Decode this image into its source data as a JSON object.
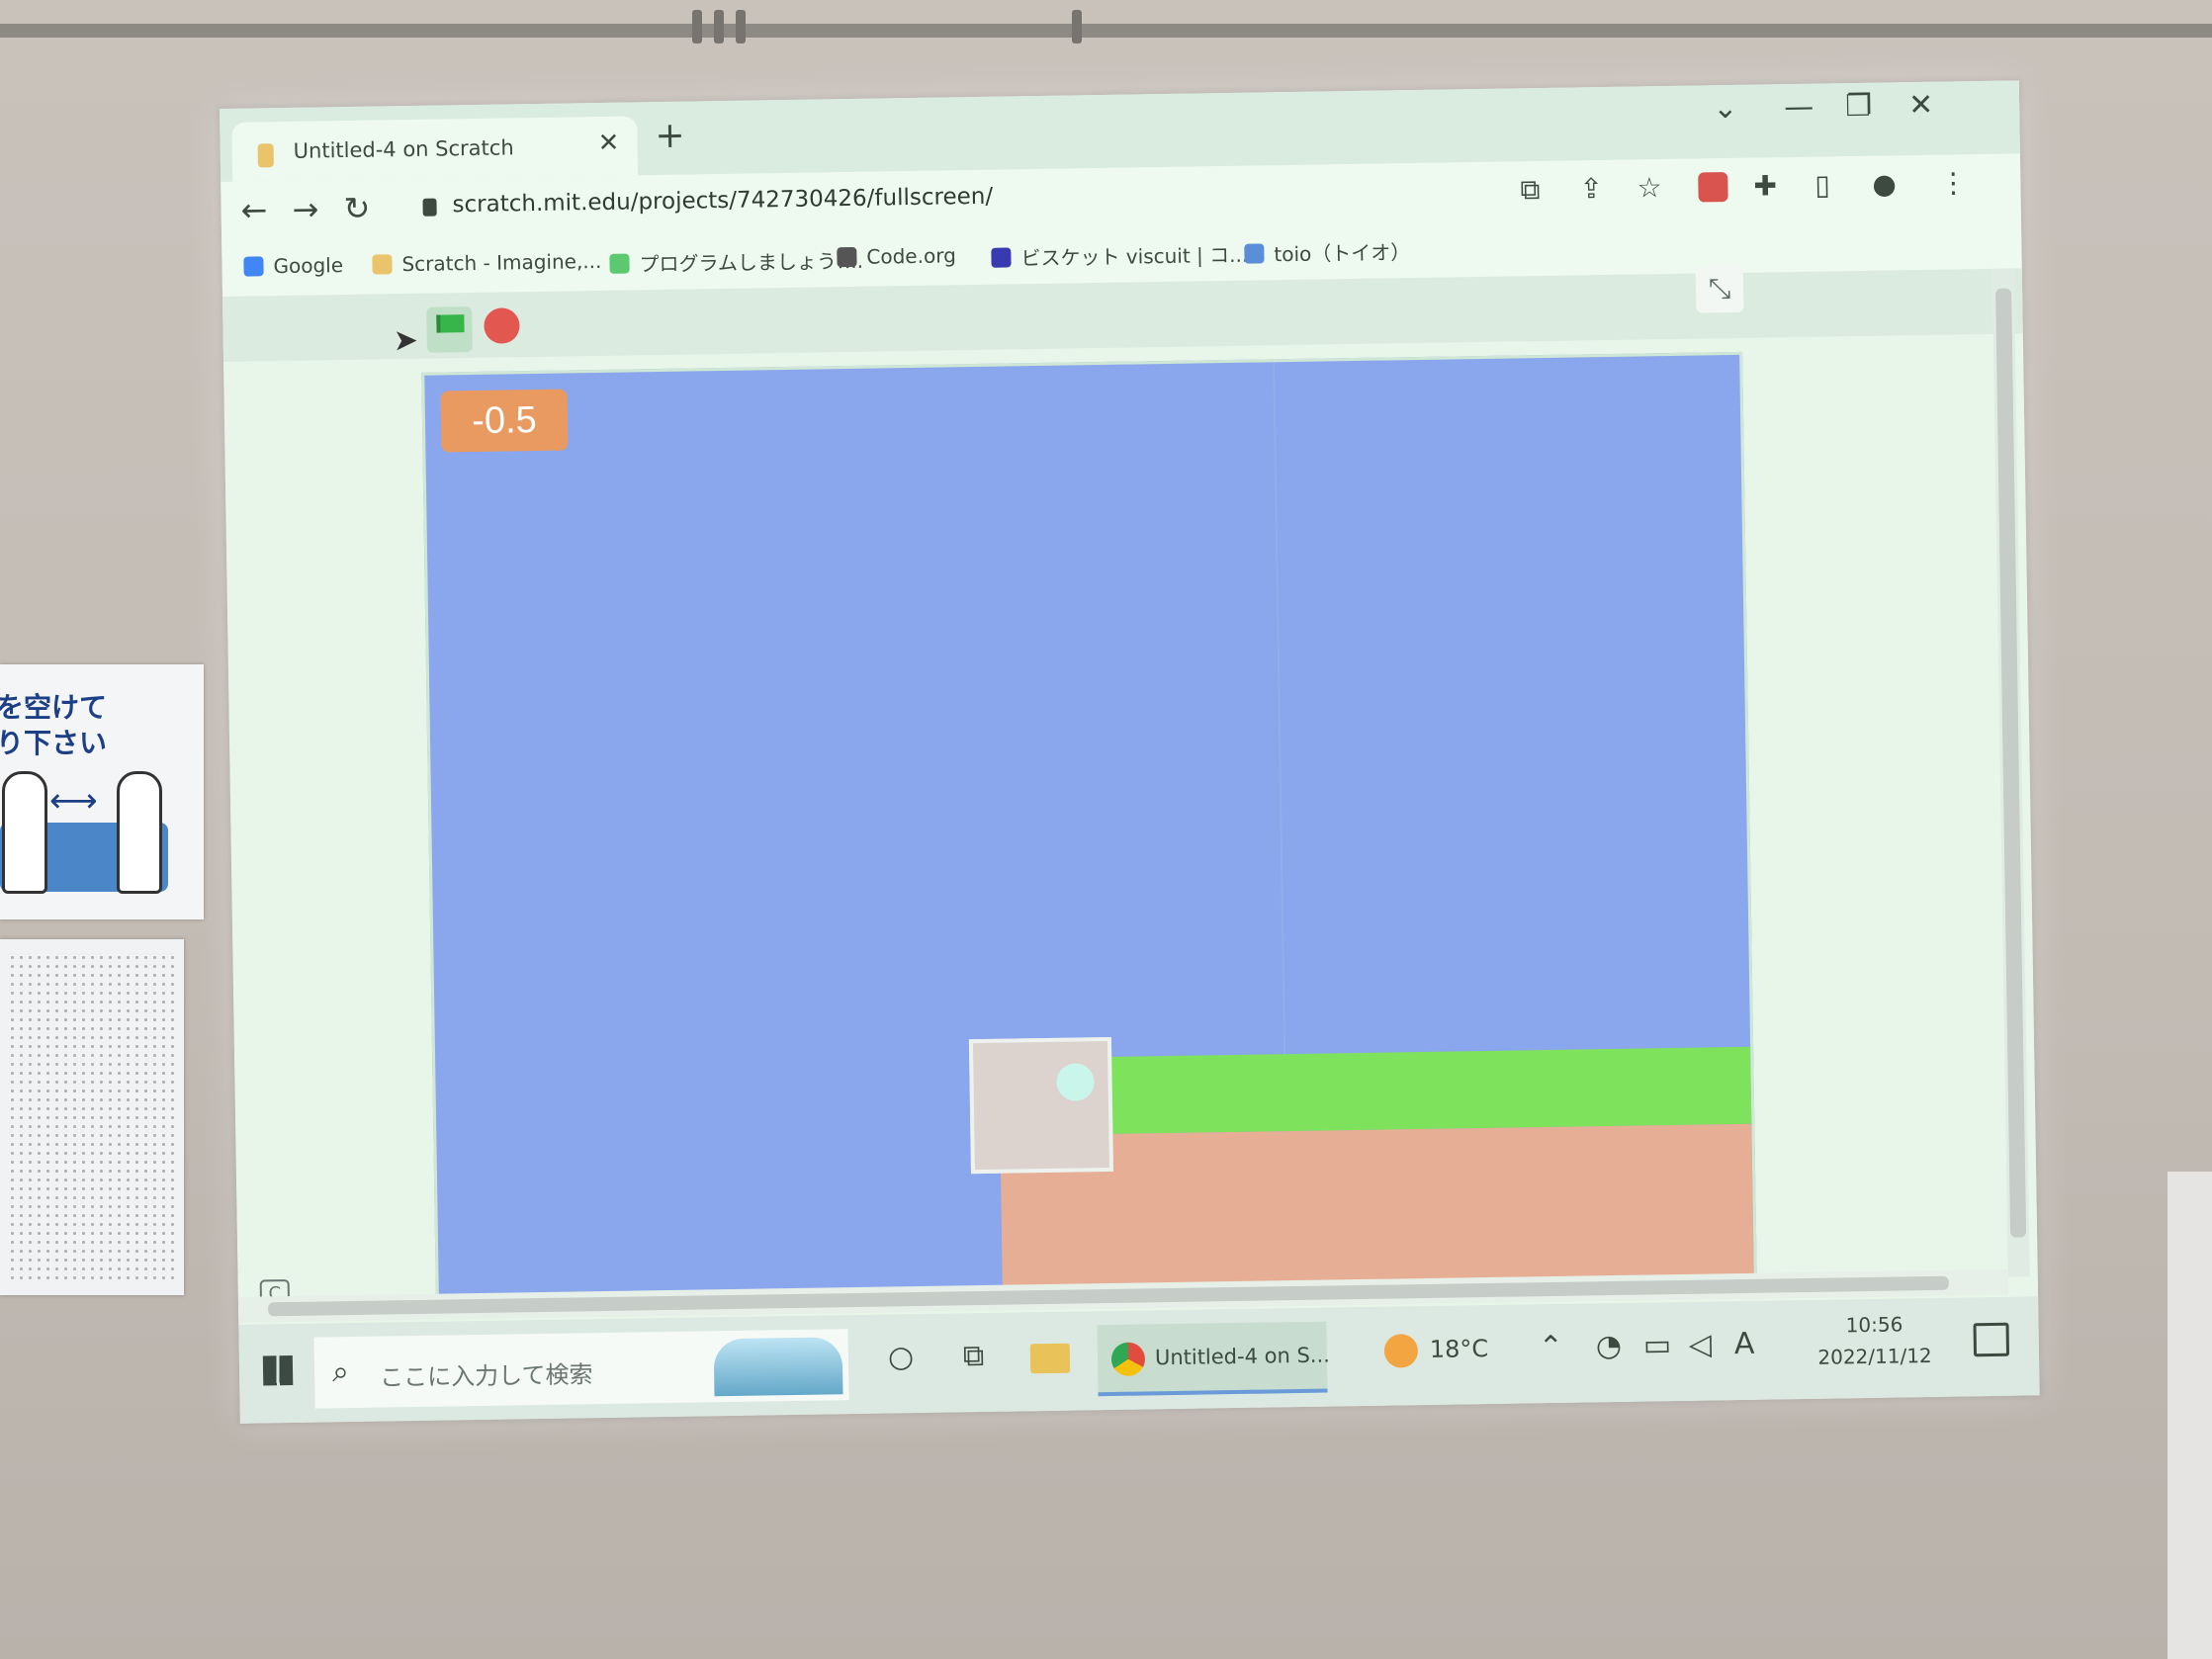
{
  "browser": {
    "tab_title": "Untitled-4 on Scratch",
    "tab_close": "✕",
    "new_tab": "+",
    "url": "scratch.mit.edu/projects/742730426/fullscreen/",
    "window_controls": {
      "collapse": "⌄",
      "minimize": "—",
      "restore": "❐",
      "close": "✕"
    },
    "nav": {
      "back": "←",
      "forward": "→",
      "reload": "↻"
    },
    "bookmarks": [
      {
        "label": "Google",
        "icon": "google-icon",
        "color": "#4285f4"
      },
      {
        "label": "Scratch - Imagine,...",
        "icon": "scratch-icon",
        "color": "#e9c46a"
      },
      {
        "label": "プログラムしましょう!...",
        "icon": "cloud-icon",
        "color": "#5cc870"
      },
      {
        "label": "Code.org",
        "icon": "grid-icon",
        "color": "#555555"
      },
      {
        "label": "ビスケット viscuit | コ...",
        "icon": "viscuit-icon",
        "color": "#3a3ab0"
      },
      {
        "label": "toio（トイオ）",
        "icon": "toio-icon",
        "color": "#5a8fd8"
      }
    ]
  },
  "scratch": {
    "variable_value": "-0.5",
    "colors": {
      "sky": "#8aa6ec",
      "grass": "#7ee25c",
      "dirt": "#e6ae94",
      "monitor": "#e99a61"
    }
  },
  "taskbar": {
    "search_placeholder": "ここに入力して検索",
    "chrome_task_label": "Untitled-4 on S...",
    "temperature": "18°C",
    "input_indicator": "A",
    "time": "10:56",
    "date": "2022/11/12"
  },
  "wall": {
    "poster_text_line1": "を空けて",
    "poster_text_line2": "り下さい"
  }
}
